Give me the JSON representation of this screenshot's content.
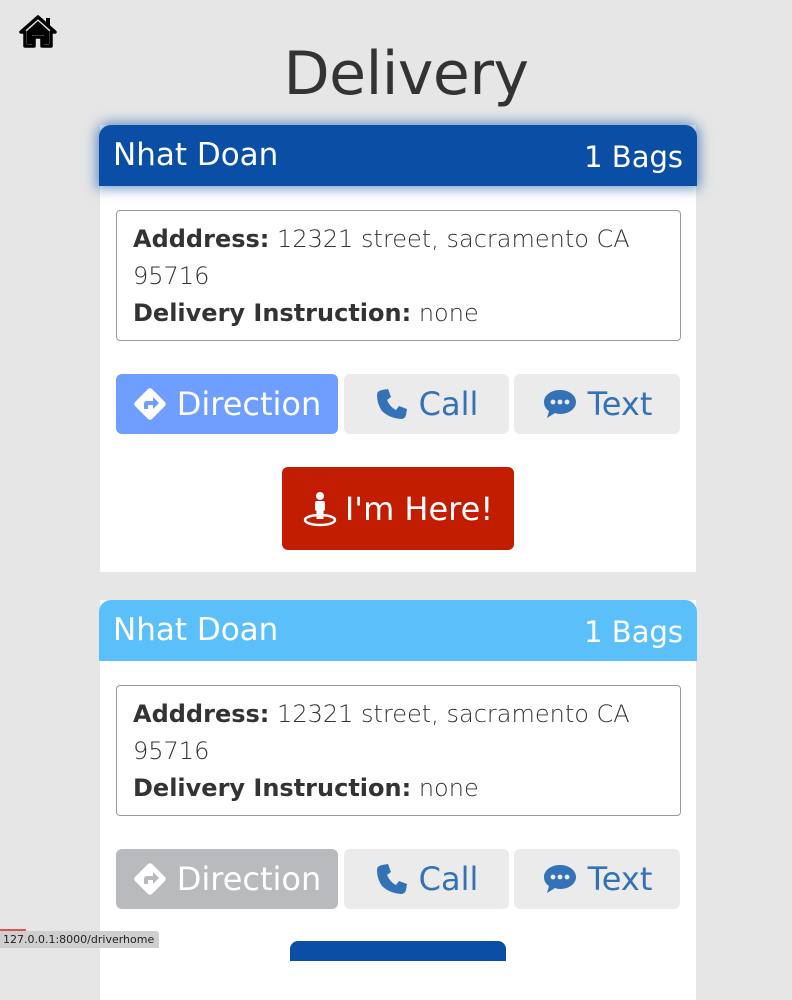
{
  "page": {
    "title": "Delivery",
    "home_icon": "home-icon"
  },
  "deliveries": [
    {
      "customer_name": "Nhat Doan",
      "bags": "1 Bags",
      "address_label": "Adddress:",
      "address_value": "12321 street, sacramento CA 95716",
      "instruction_label": "Delivery Instruction:",
      "instruction_value": "none",
      "direction_label": "Direction",
      "call_label": "Call",
      "text_label": "Text",
      "here_label": "I'm Here!",
      "header_color": "#0a4ea6",
      "direction_color": "#6e9eff"
    },
    {
      "customer_name": "Nhat Doan",
      "bags": "1 Bags",
      "address_label": "Adddress:",
      "address_value": "12321 street, sacramento CA 95716",
      "instruction_label": "Delivery Instruction:",
      "instruction_value": "none",
      "direction_label": "Direction",
      "call_label": "Call",
      "text_label": "Text",
      "header_color": "#5bc0fa",
      "direction_color": "#b9babd"
    }
  ],
  "colors": {
    "here_button": "#c21d00",
    "link_blue": "#3472b7",
    "background": "#e6e6e6"
  },
  "status_bar": {
    "url": "127.0.0.1:8000/driverhome"
  }
}
